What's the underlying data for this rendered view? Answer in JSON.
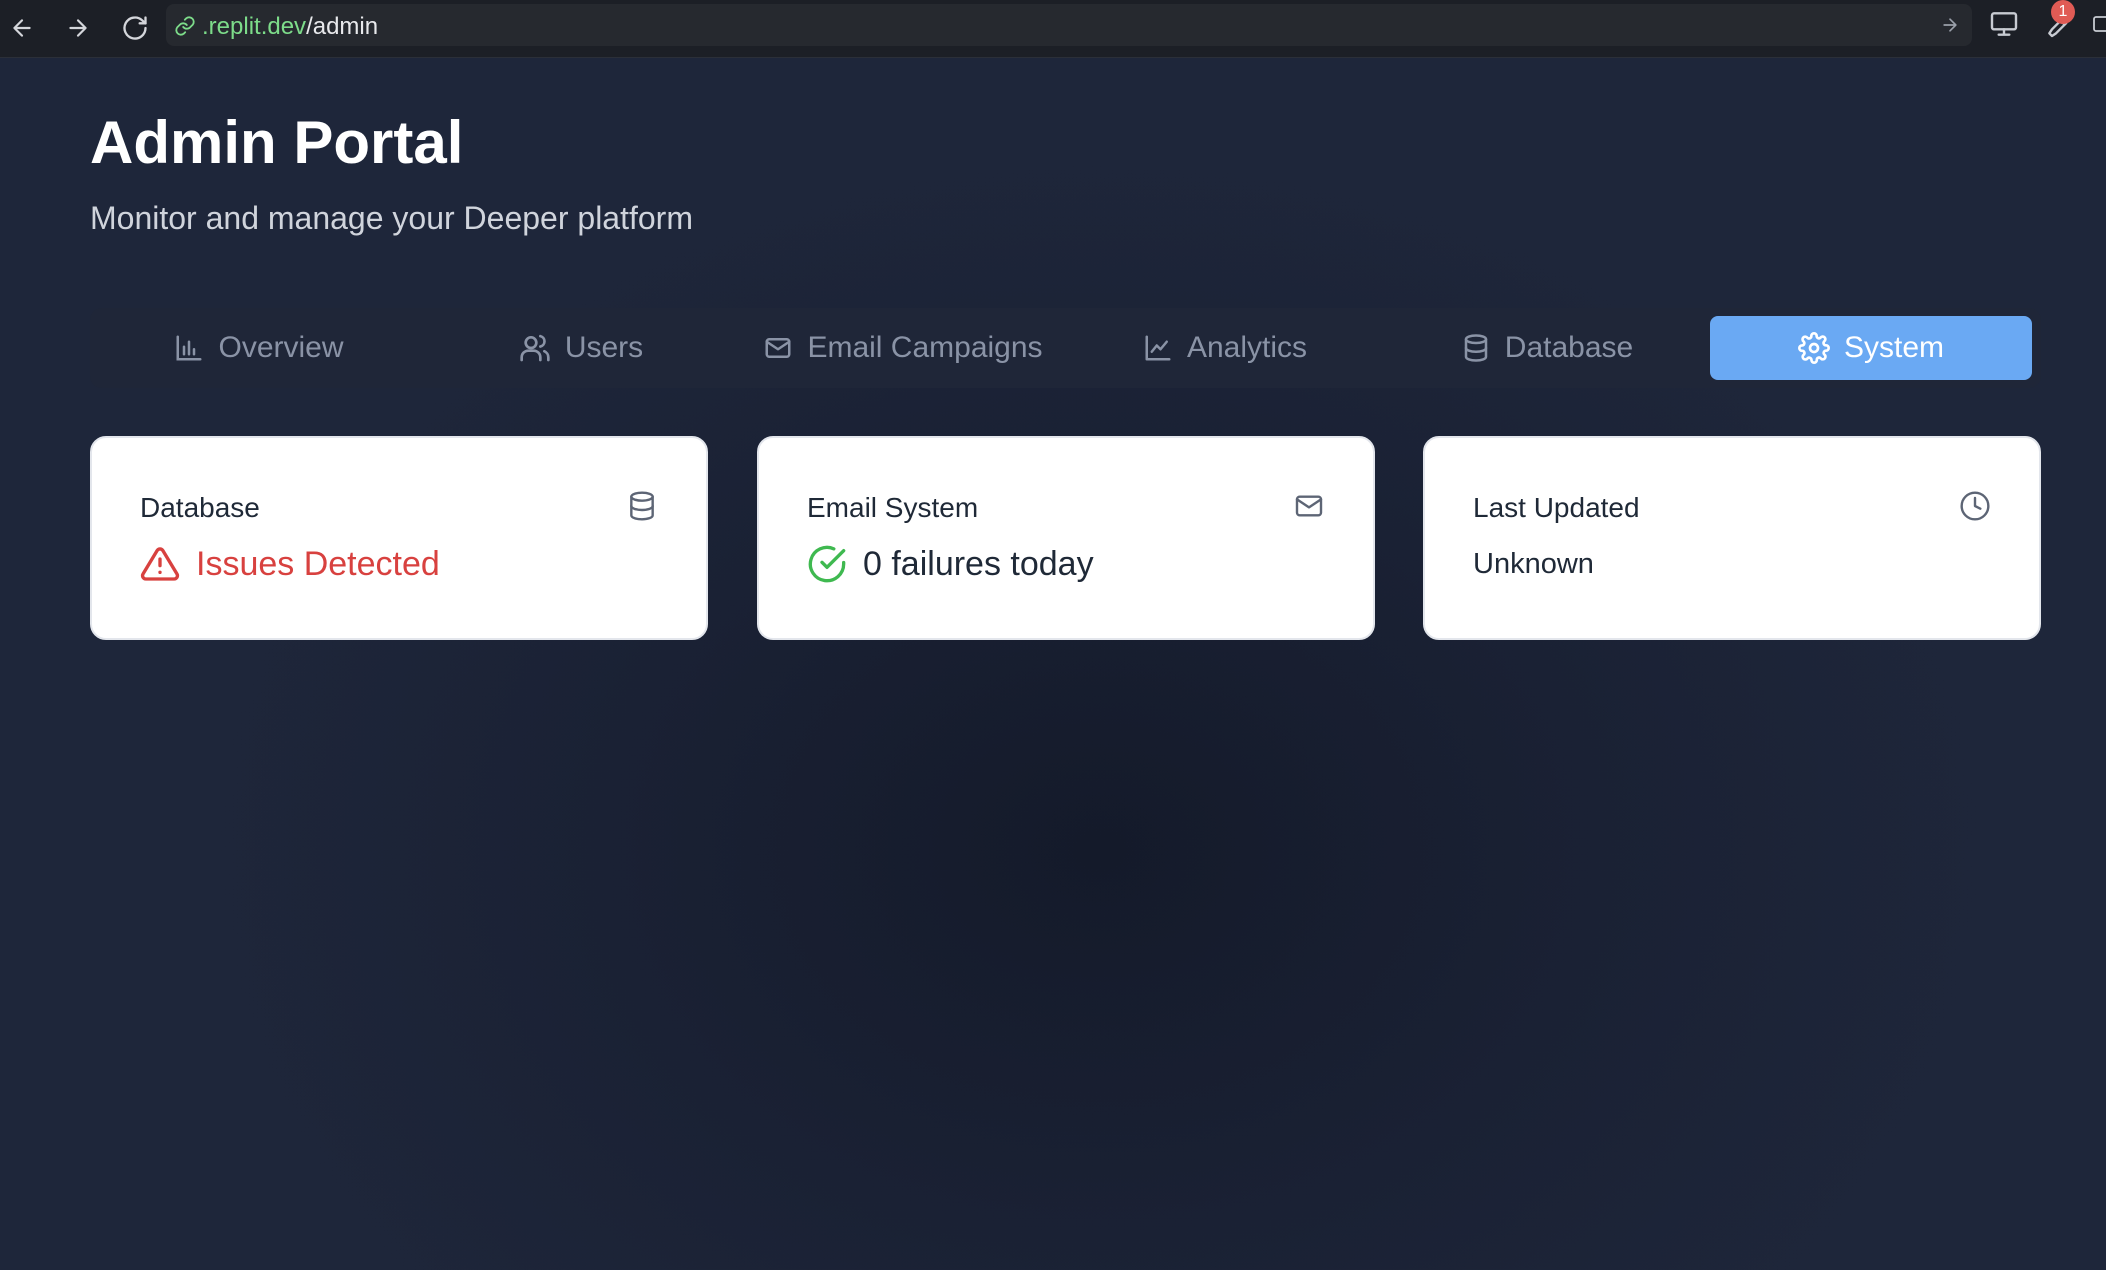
{
  "browser": {
    "url_domain": ".replit.dev",
    "url_path": "/admin",
    "notification_count": "1"
  },
  "header": {
    "title": "Admin Portal",
    "subtitle": "Monitor and manage your Deeper platform"
  },
  "tabs": [
    {
      "label": "Overview",
      "icon": "bar-chart-icon",
      "active": false
    },
    {
      "label": "Users",
      "icon": "users-icon",
      "active": false
    },
    {
      "label": "Email Campaigns",
      "icon": "mail-icon",
      "active": false
    },
    {
      "label": "Analytics",
      "icon": "line-chart-icon",
      "active": false
    },
    {
      "label": "Database",
      "icon": "database-icon",
      "active": false
    },
    {
      "label": "System",
      "icon": "gear-icon",
      "active": true
    }
  ],
  "cards": {
    "database": {
      "title": "Database",
      "icon": "database-icon",
      "status": "Issues Detected",
      "status_icon": "warning-icon",
      "status_color": "#d8413f"
    },
    "email": {
      "title": "Email System",
      "icon": "mail-icon",
      "status": "0 failures today",
      "status_icon": "check-circle-icon",
      "status_icon_color": "#3fb950"
    },
    "last_updated": {
      "title": "Last Updated",
      "icon": "clock-icon",
      "value": "Unknown"
    }
  },
  "colors": {
    "accent": "#6aa9f3",
    "error": "#d8413f",
    "success": "#3fb950"
  }
}
